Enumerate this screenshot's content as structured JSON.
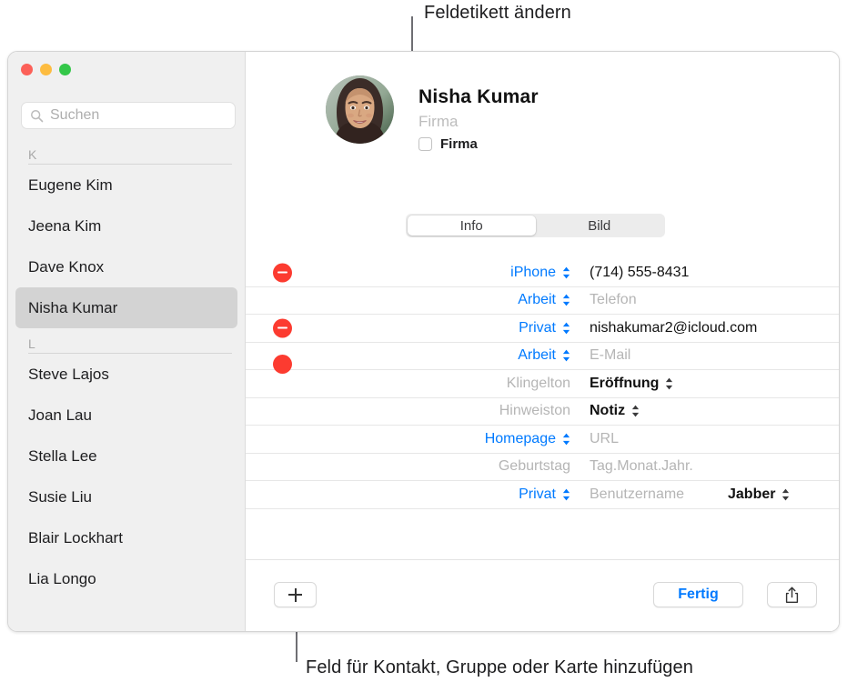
{
  "callouts": {
    "top": "Feldetikett ändern",
    "bottom": "Feld für Kontakt, Gruppe oder Karte hinzufügen"
  },
  "window": {
    "traffic_lights": {
      "close_label": "close-button",
      "minimize_label": "minimize-button",
      "maximize_label": "maximize-button",
      "close_color": "#fc6058",
      "minimize_color": "#fdbc40",
      "maximize_color": "#34c749"
    }
  },
  "sidebar": {
    "search": {
      "placeholder": "Suchen",
      "value": "",
      "icon": "search-icon"
    },
    "sections": [
      {
        "letter": "K",
        "contacts": [
          {
            "name": "Eugene Kim",
            "selected": false
          },
          {
            "name": "Jeena Kim",
            "selected": false
          },
          {
            "name": "Dave Knox",
            "selected": false
          },
          {
            "name": "Nisha Kumar",
            "selected": true
          }
        ]
      },
      {
        "letter": "L",
        "contacts": [
          {
            "name": "Steve Lajos",
            "selected": false
          },
          {
            "name": "Joan Lau",
            "selected": false
          },
          {
            "name": "Stella Lee",
            "selected": false
          },
          {
            "name": "Susie Liu",
            "selected": false
          },
          {
            "name": "Blair Lockhart",
            "selected": false
          },
          {
            "name": "Lia Longo",
            "selected": false
          }
        ]
      }
    ]
  },
  "detail": {
    "avatar": "contact-photo",
    "name": "Nisha  Kumar",
    "company_placeholder": "Firma",
    "company_checkbox_label": "Firma",
    "company_checkbox_checked": false,
    "tabs": [
      {
        "label": "Info",
        "active": true
      },
      {
        "label": "Bild",
        "active": false
      }
    ],
    "fields": [
      {
        "id": "phone-iphone",
        "has_minus": true,
        "label": "iPhone",
        "label_color": "blue",
        "has_label_stepper": true,
        "stepper_color": "blue",
        "value": "(714) 555-8431",
        "value_is_placeholder": false,
        "value_bold": false
      },
      {
        "id": "phone-work",
        "has_minus": false,
        "label": "Arbeit",
        "label_color": "blue",
        "has_label_stepper": true,
        "stepper_color": "blue",
        "value": "Telefon",
        "value_is_placeholder": true,
        "value_bold": false
      },
      {
        "id": "email-home",
        "has_minus": true,
        "label": "Privat",
        "label_color": "blue",
        "has_label_stepper": true,
        "stepper_color": "blue",
        "value": "nishakumar2@icloud.com",
        "value_is_placeholder": false,
        "value_bold": false
      },
      {
        "id": "email-work",
        "has_minus": false,
        "label": "Arbeit",
        "label_color": "blue",
        "has_label_stepper": true,
        "stepper_color": "blue",
        "value": "E-Mail",
        "value_is_placeholder": true,
        "value_bold": false
      },
      {
        "id": "ringtone",
        "has_minus": false,
        "label": "Klingelton",
        "label_color": "gray",
        "has_label_stepper": false,
        "stepper_color": "dark",
        "value": "Eröffnung",
        "value_is_placeholder": false,
        "value_bold": true,
        "value_stepper": true
      },
      {
        "id": "text-tone",
        "has_minus": false,
        "label": "Hinweiston",
        "label_color": "gray",
        "has_label_stepper": false,
        "stepper_color": "dark",
        "value": "Notiz",
        "value_is_placeholder": false,
        "value_bold": true,
        "value_stepper": true
      },
      {
        "id": "homepage",
        "has_minus": false,
        "label": "Homepage",
        "label_color": "blue",
        "has_label_stepper": true,
        "stepper_color": "blue",
        "value": "URL",
        "value_is_placeholder": true,
        "value_bold": false
      },
      {
        "id": "birthday",
        "has_minus": false,
        "label": "Geburtstag",
        "label_color": "gray",
        "has_label_stepper": false,
        "stepper_color": "dark",
        "value": "Tag.Monat.Jahr.",
        "value_is_placeholder": true,
        "value_bold": false
      },
      {
        "id": "instant-message",
        "has_minus": false,
        "label": "Privat",
        "label_color": "blue",
        "has_label_stepper": true,
        "stepper_color": "blue",
        "value": "Benutzername",
        "value_is_placeholder": true,
        "value_bold": false,
        "secondary_value": "Jabber",
        "secondary_stepper": true
      }
    ]
  },
  "toolbar": {
    "add_label": "add-field-icon",
    "done_label": "Fertig",
    "share_label": "share-icon"
  }
}
